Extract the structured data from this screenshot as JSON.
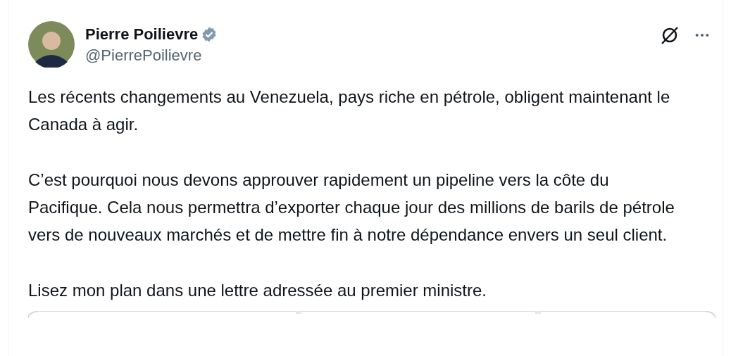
{
  "author": {
    "name": "Pierre Poilievre",
    "handle": "@PierrePoilievre",
    "verified": true
  },
  "paragraphs": [
    "Les récents changements au Venezuela, pays riche en pétrole, obligent maintenant le Canada à agir.",
    "C’est pourquoi nous devons approuver rapidement un pipeline vers la côte du Pacifique. Cela nous permettra d’exporter chaque jour des millions de barils de pétrole vers de nouveaux marchés et de mettre fin à notre dépendance envers un seul client.",
    "Lisez mon plan dans une lettre adressée au premier ministre."
  ]
}
